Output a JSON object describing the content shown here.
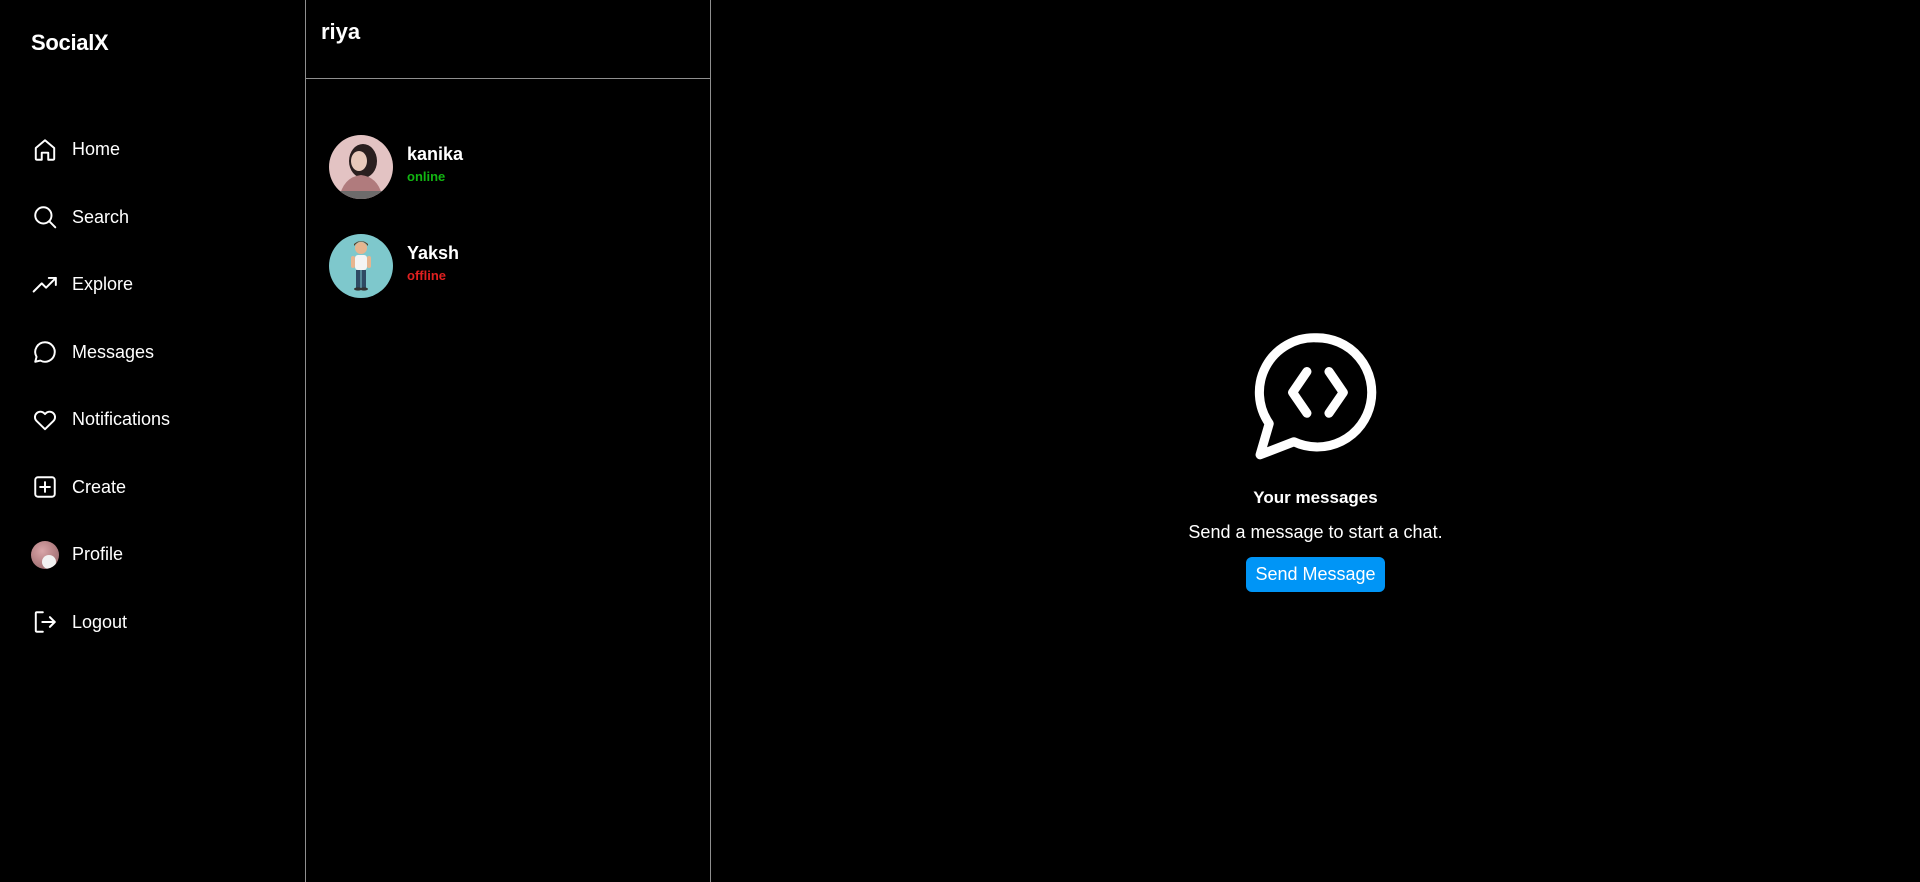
{
  "app": {
    "brand": "SocialX"
  },
  "nav": {
    "items": [
      {
        "label": "Home",
        "icon": "home-icon"
      },
      {
        "label": "Search",
        "icon": "search-icon"
      },
      {
        "label": "Explore",
        "icon": "trending-icon"
      },
      {
        "label": "Messages",
        "icon": "message-icon"
      },
      {
        "label": "Notifications",
        "icon": "heart-icon"
      },
      {
        "label": "Create",
        "icon": "plus-square-icon"
      },
      {
        "label": "Profile",
        "icon": "avatar"
      },
      {
        "label": "Logout",
        "icon": "logout-icon"
      }
    ]
  },
  "conversations": {
    "current_user": "riya",
    "items": [
      {
        "name": "kanika",
        "status": "online",
        "status_color": "#12b512"
      },
      {
        "name": "Yaksh",
        "status": "offline",
        "status_color": "#e02020"
      }
    ]
  },
  "empty_state": {
    "icon": "chat-code-icon",
    "title": "Your messages",
    "subtitle": "Send a message to start a chat.",
    "button_label": "Send Message",
    "button_color": "#0095f6"
  }
}
